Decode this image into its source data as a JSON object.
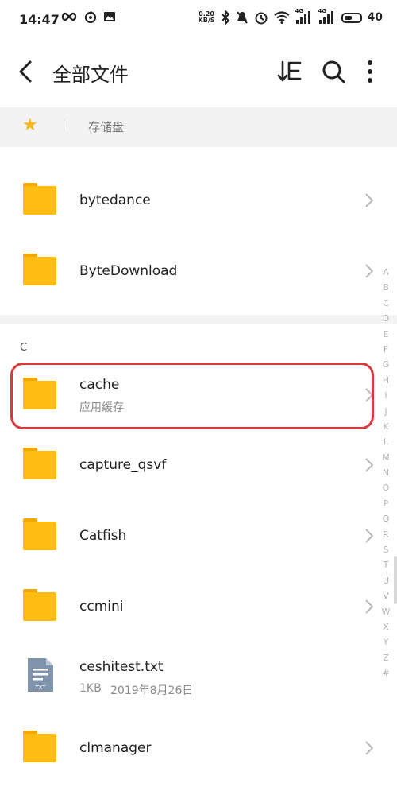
{
  "status_bar": {
    "time": "14:47",
    "net_speed_value": "0.20",
    "net_speed_unit": "KB/S",
    "signal_1_label": "4G",
    "signal_2_label": "4G",
    "battery": "40",
    "icons": [
      "infinity-icon",
      "sync-icon",
      "image-icon",
      "bluetooth-icon",
      "mute-icon",
      "alarm-icon",
      "wifi-icon",
      "signal-icon",
      "battery-icon"
    ]
  },
  "header": {
    "title": "全部文件",
    "icons": [
      "back-arrow-icon",
      "sort-icon",
      "search-icon",
      "more-icon"
    ]
  },
  "breadcrumb": {
    "root_label": "存储盘",
    "star_color": "#f6b71f"
  },
  "section_letter": "C",
  "files": [
    {
      "name": "bytedance",
      "type": "folder"
    },
    {
      "name": "ByteDownload",
      "type": "folder"
    },
    {
      "name": "cache",
      "type": "folder",
      "subtitle": "应用缓存"
    },
    {
      "name": "capture_qsvf",
      "type": "folder"
    },
    {
      "name": "Catfish",
      "type": "folder"
    },
    {
      "name": "ccmini",
      "type": "folder"
    },
    {
      "name": "ceshitest.txt",
      "type": "txt",
      "size": "1KB",
      "date": "2019年8月26日"
    },
    {
      "name": "clmanager",
      "type": "folder"
    }
  ],
  "txt_badge": "TXT",
  "index_letters": [
    "A",
    "B",
    "C",
    "D",
    "E",
    "F",
    "G",
    "H",
    "I",
    "J",
    "K",
    "L",
    "M",
    "N",
    "O",
    "P",
    "Q",
    "R",
    "S",
    "T",
    "U",
    "V",
    "W",
    "X",
    "Y",
    "Z",
    "#"
  ],
  "colors": {
    "folder": "#ffbc13",
    "highlight": "#d73b3b",
    "txt_icon": "#7f93ab"
  }
}
